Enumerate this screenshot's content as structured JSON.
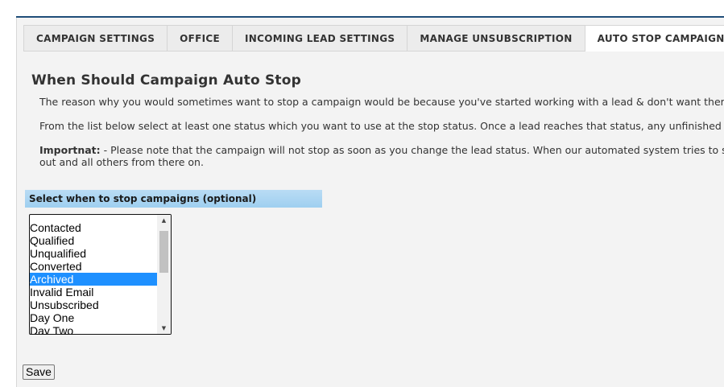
{
  "tabs": [
    {
      "label": "CAMPAIGN SETTINGS",
      "active": false
    },
    {
      "label": "OFFICE",
      "active": false
    },
    {
      "label": "INCOMING LEAD SETTINGS",
      "active": false
    },
    {
      "label": "MANAGE UNSUBSCRIPTION",
      "active": false
    },
    {
      "label": "AUTO STOP CAMPAIGN",
      "active": true
    }
  ],
  "content": {
    "heading": "When Should Campaign Auto Stop",
    "paragraph_1": "The reason why you would sometimes want to stop a campaign would be because you've started working with a lead & don't want them to g",
    "paragraph_2": "From the list below select at least one status which you want to use at the stop status.  Once a lead reaches that status, any unfinished actio",
    "paragraph_3_label": "Importnat:",
    "paragraph_3_line1": " - Please note that the campaign will not stop as soon as you change the lead status. When our automated system tries to send",
    "paragraph_3_line2": "out and all others from there on."
  },
  "stop_select": {
    "header": "Select when to stop campaigns (optional)",
    "options": [
      "",
      "Contacted",
      "Qualified",
      "Unqualified",
      "Converted",
      "Archived",
      "Invalid Email",
      "Unsubscribed",
      "Day One",
      "Day Two"
    ],
    "selected": "Archived",
    "scroll_up_icon": "triangle-up-icon",
    "scroll_down_icon": "triangle-down-icon"
  },
  "actions": {
    "save_label": "Save"
  },
  "colors": {
    "accent_line": "#1f4e79",
    "select_header_bg": "#a8d4f2",
    "selected_option_bg": "#1e90ff",
    "panel_bg": "#f3f3f3"
  }
}
